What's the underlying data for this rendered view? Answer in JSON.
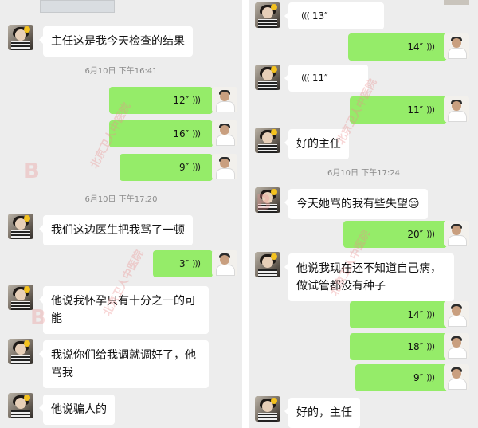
{
  "left": {
    "messages": [
      {
        "type": "text",
        "from": "her",
        "text": "主任这是我今天检查的结果"
      },
      {
        "type": "time",
        "text": "6月10日 下午16:41"
      },
      {
        "type": "voice",
        "from": "me",
        "duration": "12″"
      },
      {
        "type": "voice",
        "from": "me",
        "duration": "16″"
      },
      {
        "type": "voice",
        "from": "me",
        "duration": "9″"
      },
      {
        "type": "time",
        "text": "6月10日 下午17:20"
      },
      {
        "type": "text",
        "from": "her",
        "text": "我们这边医生把我骂了一顿"
      },
      {
        "type": "voice",
        "from": "me",
        "duration": "3″"
      },
      {
        "type": "text",
        "from": "her",
        "lines": [
          "他说我怀孕只有十分之一的可",
          "能"
        ]
      },
      {
        "type": "text",
        "from": "her",
        "lines": [
          "我说你们给我调就调好了，他",
          "骂我"
        ]
      },
      {
        "type": "text",
        "from": "her",
        "text": "他说骗人的"
      }
    ]
  },
  "right": {
    "messages": [
      {
        "type": "voice",
        "from": "her",
        "duration": "13″"
      },
      {
        "type": "voice",
        "from": "me",
        "duration": "14″"
      },
      {
        "type": "voice",
        "from": "her",
        "duration": "11″"
      },
      {
        "type": "voice",
        "from": "me",
        "duration": "11″"
      },
      {
        "type": "text",
        "from": "her",
        "text": "好的主任"
      },
      {
        "type": "time",
        "text": "6月10日 下午17:24"
      },
      {
        "type": "text",
        "from": "her",
        "text": "今天她骂的我有些失望",
        "emoji": "😔"
      },
      {
        "type": "voice",
        "from": "me",
        "duration": "20″"
      },
      {
        "type": "text",
        "from": "her",
        "lines": [
          "他说我现在还不知道自己病，",
          "做试管都没有种子"
        ]
      },
      {
        "type": "voice",
        "from": "me",
        "duration": "14″"
      },
      {
        "type": "voice",
        "from": "me",
        "duration": "18″"
      },
      {
        "type": "voice",
        "from": "me",
        "duration": "9″"
      },
      {
        "type": "text",
        "from": "her",
        "text": "好的，主任"
      }
    ]
  },
  "watermark": {
    "text": "北京卫人中医院",
    "badge": "B"
  },
  "icons": {
    "voice_wave": "voice-wave-icon",
    "avatar_patient": "patient-avatar",
    "avatar_doctor": "doctor-avatar"
  },
  "colors": {
    "outgoing": "#95ec69",
    "incoming": "#ffffff",
    "background": "#ededed",
    "timestamp": "#8a8a8a"
  }
}
